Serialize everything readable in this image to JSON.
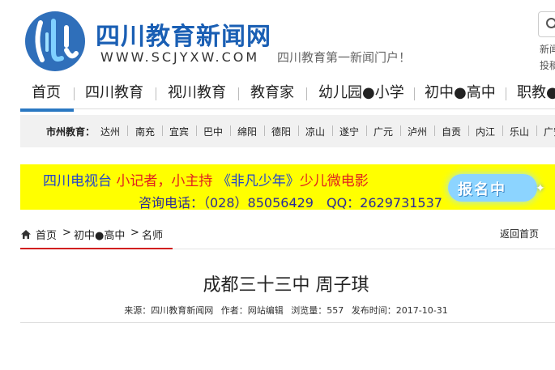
{
  "header": {
    "site_name": "四川教育新闻网",
    "site_url": "WWW.SCJYXW.COM",
    "slogan": "四川教育第一新闻门户！",
    "side_links": [
      "新闻",
      "投稿"
    ]
  },
  "main_nav": {
    "items": [
      "首页",
      "四川教育",
      "视川教育",
      "教育家",
      "幼儿园●小学",
      "初中●高中",
      "职教●"
    ],
    "active": "首页"
  },
  "city_bar": {
    "label": "市州教育：",
    "cities": [
      "达州",
      "南充",
      "宜宾",
      "巴中",
      "绵阳",
      "德阳",
      "凉山",
      "遂宁",
      "广元",
      "泸州",
      "自贡",
      "内江",
      "乐山",
      "广安"
    ]
  },
  "banner": {
    "part1": "四川电视台",
    "part2": "小记者，小主持",
    "part3": "《非凡少年》",
    "part4": "少儿微电影",
    "line2": "咨询电话：（028）85056429　QQ：2629731537",
    "badge": "报名中",
    "colors": {
      "background": "#ffff00",
      "blue": "#2244cc",
      "red": "#e02020"
    }
  },
  "breadcrumb": {
    "items": [
      "首页",
      "初中●高中",
      "名师"
    ],
    "separator": ">",
    "back_link": "返回首页"
  },
  "article": {
    "title": "成都三十三中 周子琪",
    "source": "来源：四川教育新闻网",
    "author": "作者：网站编辑",
    "views": "浏览量：557",
    "published": "发布时间：2017-10-31"
  },
  "accent": "#2a78c2"
}
